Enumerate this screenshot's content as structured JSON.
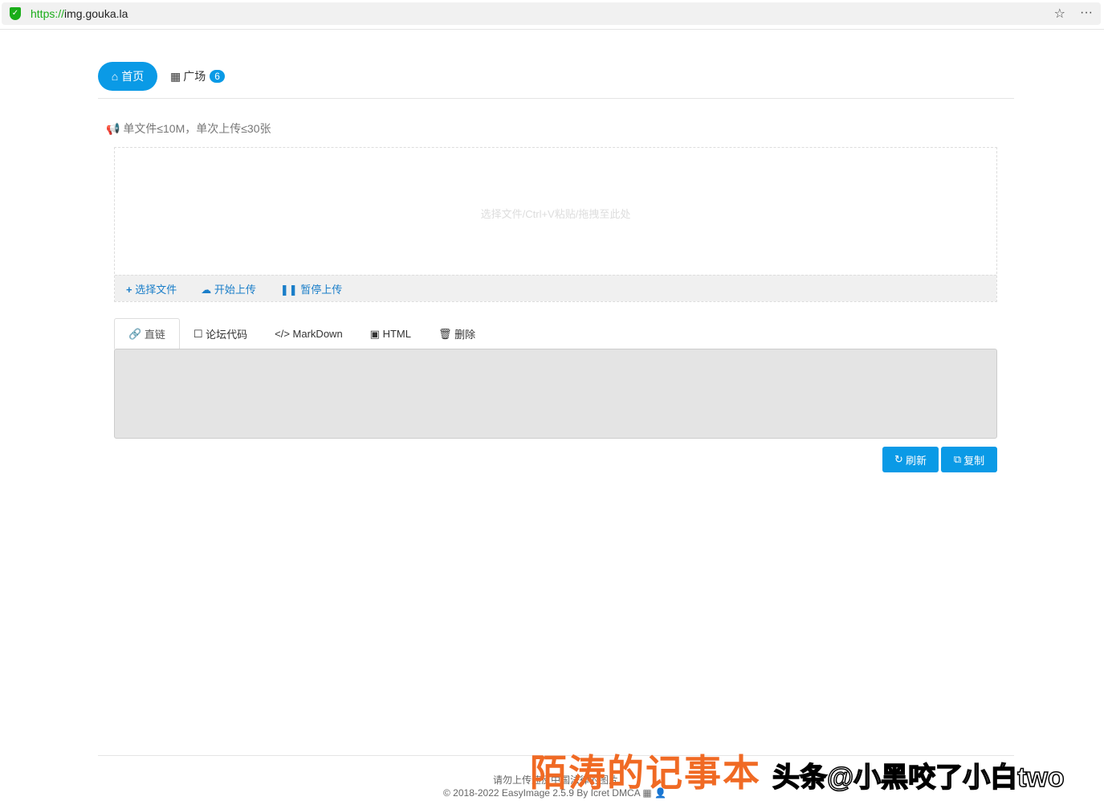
{
  "browser": {
    "url_scheme": "https://",
    "url_host": "img.gouka.la"
  },
  "nav": {
    "home": "首页",
    "square": "广场",
    "square_badge": "6"
  },
  "notice": "单文件≤10M，单次上传≤30张",
  "upload": {
    "hint": "选择文件/Ctrl+V粘贴/拖拽至此处",
    "choose": "选择文件",
    "start": "开始上传",
    "pause": "暂停上传"
  },
  "tabs": [
    "直链",
    "论坛代码",
    "MarkDown",
    "HTML",
    "删除"
  ],
  "buttons": {
    "refresh": "刷新",
    "copy": "复制"
  },
  "footer": {
    "line1": "请勿上传违反中国法律的图片",
    "line2": "© 2018-2022 EasyImage 2.5.9 By Icret DMCA"
  },
  "watermarks": [
    "陌涛的记事本",
    "头条@小黑咬了小白two"
  ],
  "colors": {
    "accent": "#0a9ae6",
    "link": "#1a7ec9"
  }
}
